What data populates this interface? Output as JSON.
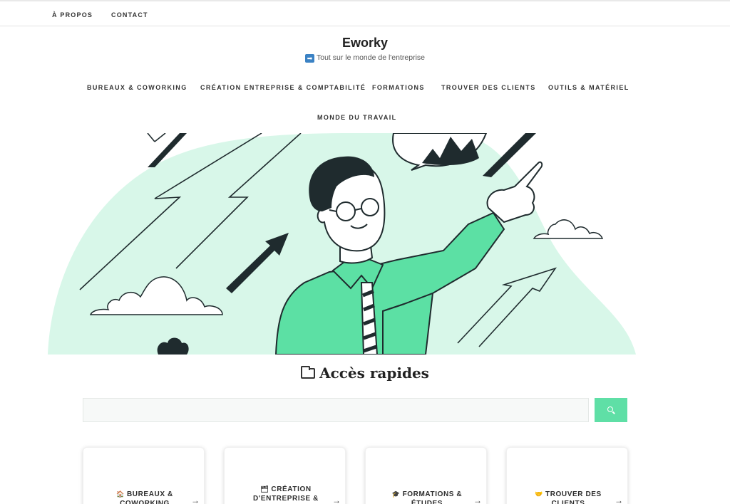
{
  "topnav": {
    "items": [
      "À PROPOS",
      "CONTACT"
    ]
  },
  "site": {
    "title": "Eworky",
    "tagline_icon": "➡",
    "tagline": "Tout sur le monde de l'entreprise"
  },
  "mainnav": {
    "items": [
      "BUREAUX & COWORKING",
      "CRÉATION ENTREPRISE & COMPTABILITÉ",
      "FORMATIONS",
      "TROUVER DES CLIENTS",
      "OUTILS & MATÉRIEL",
      "MONDE DU TRAVAIL"
    ]
  },
  "hero": {
    "image_subject": "businessman-pointing-illustration",
    "colors": {
      "blob": "#d8f7e9",
      "shirt": "#5ce0a4",
      "ink": "#1f2b2e"
    }
  },
  "quick_access": {
    "title": "Accès rapides",
    "icon": "card-index-dividers-icon"
  },
  "search": {
    "placeholder": "",
    "button_icon": "search-icon",
    "button_color": "#5fdfa6"
  },
  "cards": [
    {
      "emoji": "🏠",
      "label": "BUREAUX & COWORKING",
      "icon": "house-icon"
    },
    {
      "emoji": "🗂",
      "label": "CRÉATION D'ENTREPRISE &",
      "icon": "folder-icon"
    },
    {
      "emoji": "🎓",
      "label": "FORMATIONS & ÉTUDES",
      "icon": "graduation-cap-icon"
    },
    {
      "emoji": "🤝",
      "label": "TROUVER DES CLIENTS",
      "icon": "handshake-icon"
    }
  ],
  "card_arrow": "→"
}
